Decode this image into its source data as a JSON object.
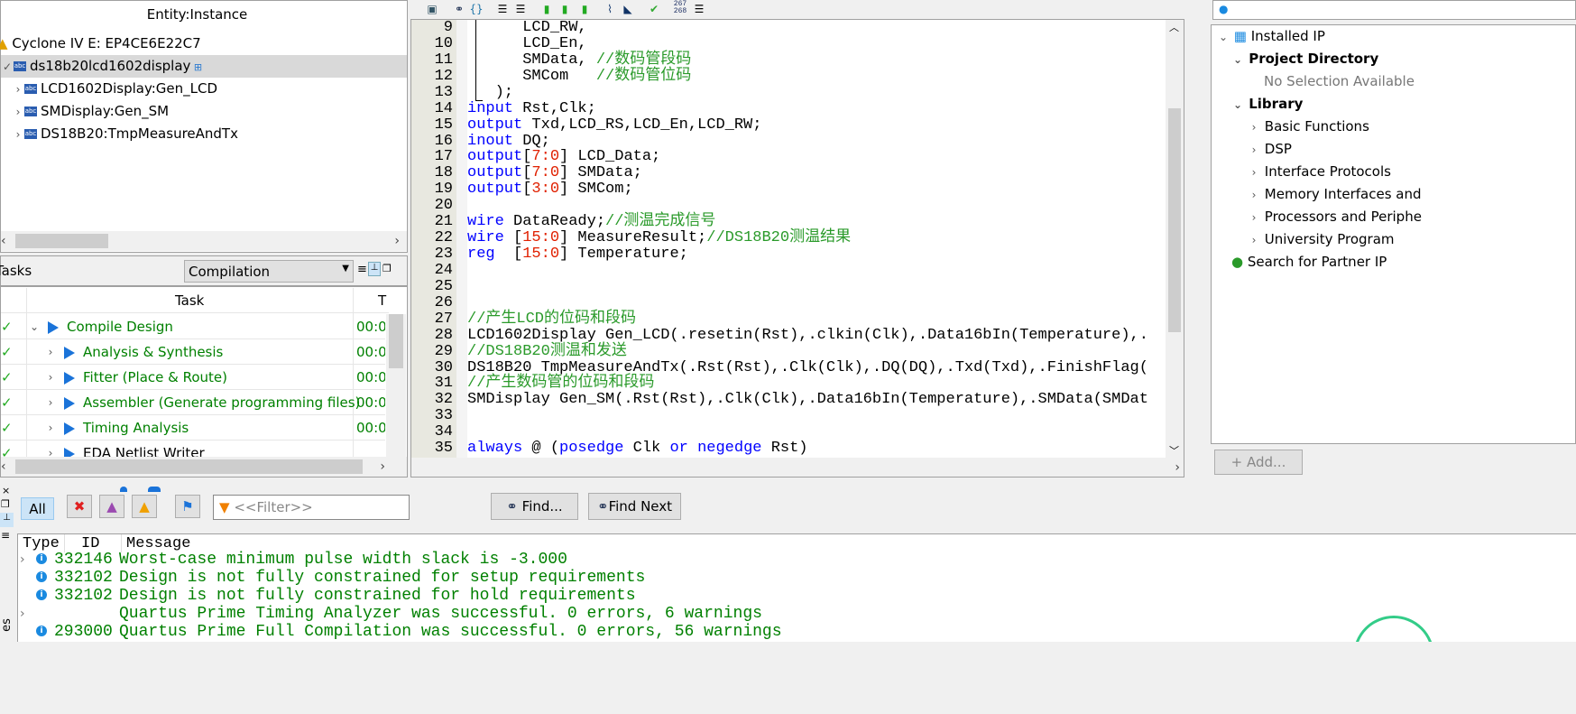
{
  "entity": {
    "header": "Entity:Instance",
    "device": "Cyclone IV E: EP4CE6E22C7",
    "top": "ds18b20lcd1602display",
    "children": [
      "LCD1602Display:Gen_LCD",
      "SMDisplay:Gen_SM",
      "DS18B20:TmpMeasureAndTx"
    ]
  },
  "tasks": {
    "title": "Tasks",
    "mode": "Compilation",
    "col_task": "Task",
    "col_time": "T",
    "rows": [
      {
        "label": "Compile Design",
        "time": "00:0"
      },
      {
        "label": "Analysis & Synthesis",
        "time": "00:0"
      },
      {
        "label": "Fitter (Place & Route)",
        "time": "00:0"
      },
      {
        "label": "Assembler (Generate programming files)",
        "time": "00:0"
      },
      {
        "label": "Timing Analysis",
        "time": "00:0"
      },
      {
        "label": "EDA Netlist Writer",
        "time": ""
      }
    ]
  },
  "editor": {
    "lines": [
      {
        "n": "9",
        "s": [
          [
            "      LCD_RW,",
            ""
          ]
        ]
      },
      {
        "n": "10",
        "s": [
          [
            "      LCD_En,",
            ""
          ]
        ]
      },
      {
        "n": "11",
        "s": [
          [
            "      SMData, ",
            ""
          ],
          [
            "//数码管段码",
            "c"
          ]
        ]
      },
      {
        "n": "12",
        "s": [
          [
            "      SMCom   ",
            ""
          ],
          [
            "//数码管位码",
            "c"
          ]
        ]
      },
      {
        "n": "13",
        "s": [
          [
            "   );",
            ""
          ]
        ]
      },
      {
        "n": "14",
        "s": [
          [
            "input",
            "k"
          ],
          [
            " Rst,Clk;",
            ""
          ]
        ]
      },
      {
        "n": "15",
        "s": [
          [
            "output",
            "k"
          ],
          [
            " Txd,LCD_RS,LCD_En,LCD_RW;",
            ""
          ]
        ]
      },
      {
        "n": "16",
        "s": [
          [
            "inout",
            "k"
          ],
          [
            " DQ;",
            ""
          ]
        ]
      },
      {
        "n": "17",
        "s": [
          [
            "output",
            "k"
          ],
          [
            "[",
            ""
          ],
          [
            "7:0",
            "n"
          ],
          [
            "] LCD_Data;",
            ""
          ]
        ]
      },
      {
        "n": "18",
        "s": [
          [
            "output",
            "k"
          ],
          [
            "[",
            ""
          ],
          [
            "7:0",
            "n"
          ],
          [
            "] SMData;",
            ""
          ]
        ]
      },
      {
        "n": "19",
        "s": [
          [
            "output",
            "k"
          ],
          [
            "[",
            ""
          ],
          [
            "3:0",
            "n"
          ],
          [
            "] SMCom;",
            ""
          ]
        ]
      },
      {
        "n": "20",
        "s": []
      },
      {
        "n": "21",
        "s": [
          [
            "wire",
            "k"
          ],
          [
            " DataReady;",
            ""
          ],
          [
            "//测温完成信号",
            "c"
          ]
        ]
      },
      {
        "n": "22",
        "s": [
          [
            "wire",
            "k"
          ],
          [
            " [",
            ""
          ],
          [
            "15:0",
            "n"
          ],
          [
            "] MeasureResult;",
            ""
          ],
          [
            "//DS18B20测温结果",
            "c"
          ]
        ]
      },
      {
        "n": "23",
        "s": [
          [
            "reg",
            "k"
          ],
          [
            "  [",
            ""
          ],
          [
            "15:0",
            "n"
          ],
          [
            "] Temperature;",
            ""
          ]
        ]
      },
      {
        "n": "24",
        "s": []
      },
      {
        "n": "25",
        "s": []
      },
      {
        "n": "26",
        "s": []
      },
      {
        "n": "27",
        "s": [
          [
            "//产生LCD的位码和段码",
            "c"
          ]
        ]
      },
      {
        "n": "28",
        "s": [
          [
            "LCD1602Display Gen_LCD(.resetin(Rst),.clkin(Clk),.Data16bIn(Temperature),.",
            ""
          ]
        ]
      },
      {
        "n": "29",
        "s": [
          [
            "//DS18B20测温和发送",
            "c"
          ]
        ]
      },
      {
        "n": "30",
        "s": [
          [
            "DS18B20 TmpMeasureAndTx(.Rst(Rst),.Clk(Clk),.DQ(DQ),.Txd(Txd),.FinishFlag(",
            ""
          ]
        ]
      },
      {
        "n": "31",
        "s": [
          [
            "//产生数码管的位码和段码",
            "c"
          ]
        ]
      },
      {
        "n": "32",
        "s": [
          [
            "SMDisplay Gen_SM(.Rst(Rst),.Clk(Clk),.Data16bIn(Temperature),.SMData(SMDat",
            ""
          ]
        ]
      },
      {
        "n": "33",
        "s": []
      },
      {
        "n": "34",
        "s": []
      },
      {
        "n": "35",
        "s": [
          [
            "always",
            "k"
          ],
          [
            " @ (",
            ""
          ],
          [
            "posedge",
            "k"
          ],
          [
            " Clk ",
            ""
          ],
          [
            "or",
            "k"
          ],
          [
            " ",
            ""
          ],
          [
            "negedge",
            "k"
          ],
          [
            " Rst)",
            ""
          ]
        ]
      }
    ],
    "toolbar_linenum": "267\n268"
  },
  "ip": {
    "installed": "Installed IP",
    "project_dir": "Project Directory",
    "no_selection": "No Selection Available",
    "library": "Library",
    "items": [
      "Basic Functions",
      "DSP",
      "Interface Protocols",
      "Memory Interfaces and",
      "Processors and Periphe",
      "University Program"
    ],
    "partner": "Search for Partner IP",
    "add": "+ Add..."
  },
  "messages": {
    "all": "All",
    "filter_placeholder": "<<Filter>>",
    "find": "Find...",
    "find_next": "Find Next",
    "col_type": "Type",
    "col_id": "ID",
    "col_message": "Message",
    "rows": [
      {
        "expand": true,
        "icon": true,
        "id": "332146",
        "text": "Worst-case minimum pulse width slack is -3.000"
      },
      {
        "expand": false,
        "icon": true,
        "id": "332102",
        "text": "Design is not fully constrained for setup requirements"
      },
      {
        "expand": false,
        "icon": true,
        "id": "332102",
        "text": "Design is not fully constrained for hold requirements"
      },
      {
        "expand": true,
        "icon": false,
        "id": "",
        "text": "Quartus Prime Timing Analyzer was successful. 0 errors, 6 warnings"
      },
      {
        "expand": false,
        "icon": true,
        "id": "293000",
        "text": "Quartus Prime Full Compilation was successful. 0 errors, 56 warnings"
      }
    ],
    "side_label": "es"
  },
  "colors": {
    "green": "#008000",
    "keyword": "#0000ff",
    "number": "#e02000",
    "comment": "#2a9a2a",
    "selection": "#d9d9d9"
  }
}
